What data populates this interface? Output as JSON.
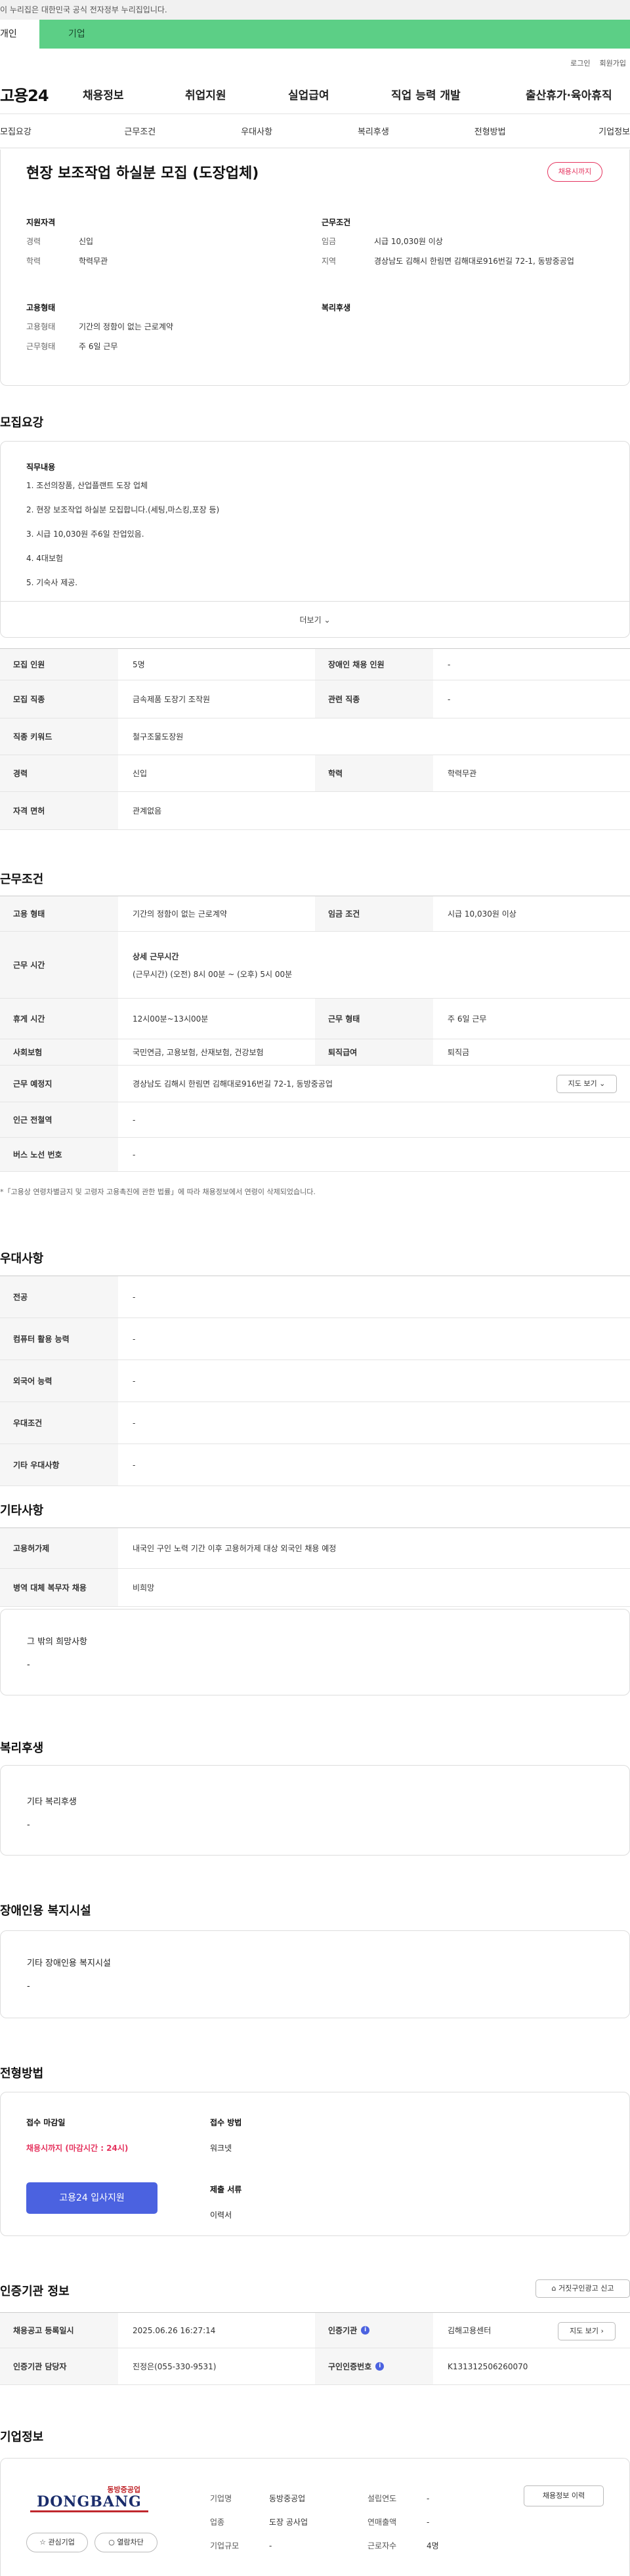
{
  "gov_banner": "이 누리집은 대한민국 공식 전자정부 누리집입니다.",
  "user_tabs": [
    "개인",
    "기업"
  ],
  "top_links": [
    "로그인",
    "회원가입"
  ],
  "logo": "고용24",
  "gnb": [
    "채용정보",
    "취업지원",
    "실업급여",
    "직업 능력 개발",
    "출산휴가·육아휴직"
  ],
  "snb": [
    "모집요강",
    "근무조건",
    "우대사항",
    "복리후생",
    "전형방법",
    "기업정보"
  ],
  "job_title": "현장 보조작업 하실분 모집 (도장업체)",
  "status_badge": "채용시까지",
  "summary": {
    "qual_title": "지원자격",
    "career_k": "경력",
    "career_v": "신입",
    "edu_k": "학력",
    "edu_v": "학력무관",
    "cond_title": "근무조건",
    "wage_k": "임금",
    "wage_v": "시급 10,030원 이상",
    "region_k": "지역",
    "region_v": "경상남도 김해시 한림면 김해대로916번길 72-1, 동방중공업",
    "emp_title": "고용형태",
    "etype_k": "고용형태",
    "etype_v": "기간의 정함이 없는 근로계약",
    "wtype_k": "근무형태",
    "wtype_v": "주 6일 근무",
    "welfare_title": "복리후생"
  },
  "recruit": {
    "heading": "모집요강",
    "duty_title": "직무내용",
    "duties": [
      "1. 조선의장품, 산업플랜트 도장 업체",
      "2.  현장 보조작업 하실분 모집합니다.(세팅,마스킹,포장 등)",
      "3. 시급 10,030원  주6일 잔업있음.",
      "4. 4대보험",
      "5. 기숙사 제공."
    ],
    "more": "더보기"
  },
  "recruit_table": [
    [
      "모집 인원",
      "5명",
      "장애인 채용 인원",
      "-"
    ],
    [
      "모집 직종",
      "금속제품 도장기 조작원",
      "관련 직종",
      "-"
    ],
    [
      "직종 키워드",
      "철구조물도장원"
    ],
    [
      "경력",
      "신입",
      "학력",
      "학력무관"
    ],
    [
      "자격 면허",
      "관계없음"
    ]
  ],
  "cond": {
    "heading": "근무조건",
    "etype_k": "고용 형태",
    "etype_v": "기간의 정함이 없는 근로계약",
    "wage_k": "임금 조건",
    "wage_v": "시급 10,030원 이상",
    "hours_k": "근무 시간",
    "hours_title": "상세 근무시간",
    "hours_v": "(근무시간) (오전) 8시 00분 ~ (오후) 5시 00분",
    "rest_k": "휴게 시간",
    "rest_v": "12시00분~13시00분",
    "wform_k": "근무 형태",
    "wform_v": "주 6일 근무",
    "ins_k": "사회보험",
    "ins_v": "국민연금, 고용보험, 산재보험, 건강보험",
    "sev_k": "퇴직급여",
    "sev_v": "퇴직금",
    "place_k": "근무 예정지",
    "place_v": "경상남도 김해시 한림면 김해대로916번길 72-1, 동방중공업",
    "map_btn": "지도 보기",
    "subway_k": "인근 전철역",
    "subway_v": "-",
    "bus_k": "버스 노선 번호",
    "bus_v": "-",
    "note": "*「고용상 연령차별금지 및 고령자 고용촉진에 관한 법률」에 따라 채용정보에서 연령이 삭제되었습니다."
  },
  "pref": {
    "heading": "우대사항",
    "rows": [
      [
        "전공",
        "-"
      ],
      [
        "컴퓨터 활용 능력",
        "-"
      ],
      [
        "외국어 능력",
        "-"
      ],
      [
        "우대조건",
        "-"
      ],
      [
        "기타 우대사항",
        "-"
      ]
    ]
  },
  "etc": {
    "heading": "기타사항",
    "rows": [
      [
        "고용허가제",
        "내국인 구인 노력 기간 이후 고용허가제 대상 외국인 채용 예정"
      ],
      [
        "병역 대체 복무자 채용",
        "비희망"
      ]
    ],
    "box_title": "그 밖의 희망사항",
    "box_v": "-"
  },
  "welfare": {
    "heading": "복리후생",
    "box_title": "기타 복리후생",
    "box_v": "-"
  },
  "disab": {
    "heading": "장애인용 복지시설",
    "box_title": "기타 장애인용 복지시설",
    "box_v": "-"
  },
  "process": {
    "heading": "전형방법",
    "deadline_k": "접수 마감일",
    "deadline_v": "채용시까지 (마감시간 : 24시)",
    "apply_btn": "고용24 입사지원",
    "method_k": "접수 방법",
    "method_v": "워크넷",
    "docs_k": "제출 서류",
    "docs_v": "이력서"
  },
  "cert": {
    "heading": "인증기관 정보",
    "report_btn": "거짓구인광고 신고",
    "rows": [
      [
        "채용공고 등록일시",
        "2025.06.26 16:27:14",
        "인증기관",
        "김해고용센터"
      ],
      [
        "인증기관 담당자",
        "진정은(055-330-9531)",
        "구인인증번호",
        "K131312506260070"
      ]
    ],
    "map_btn": "지도 보기"
  },
  "company": {
    "heading": "기업정보",
    "logo_text": "동방중공업",
    "logo_big": "DONGBANG",
    "fav_btn": "관심기업",
    "block_btn": "열람차단",
    "history_btn": "채용정보 이력",
    "rows": [
      [
        "기업명",
        "동방중공업",
        "설립연도",
        "-"
      ],
      [
        "업종",
        "도장 공사업",
        "연매출액",
        "-"
      ],
      [
        "기업규모",
        "-",
        "근로자수",
        "4명"
      ]
    ]
  }
}
